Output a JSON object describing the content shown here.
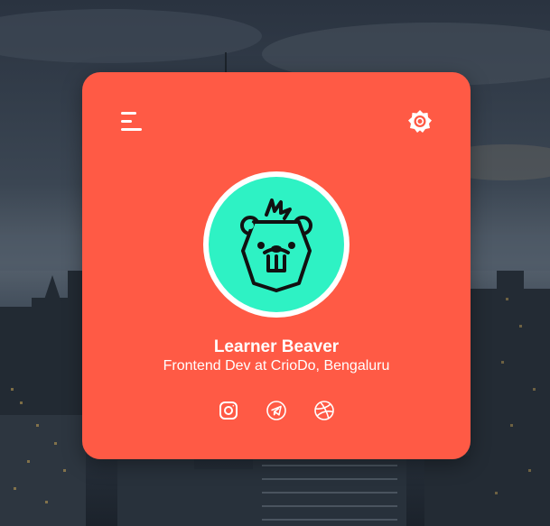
{
  "theme": {
    "card_color": "#ff5a45",
    "avatar_color": "#2ef2c4",
    "text_color": "#ffffff"
  },
  "header": {
    "menu_icon": "hamburger-menu-icon",
    "theme_icon": "sun-icon"
  },
  "profile": {
    "avatar_icon": "beaver-icon",
    "name": "Learner Beaver",
    "role": "Frontend Dev at CrioDo, Bengaluru"
  },
  "social_links": [
    {
      "icon": "instagram-icon"
    },
    {
      "icon": "telegram-icon"
    },
    {
      "icon": "dribbble-icon"
    }
  ]
}
